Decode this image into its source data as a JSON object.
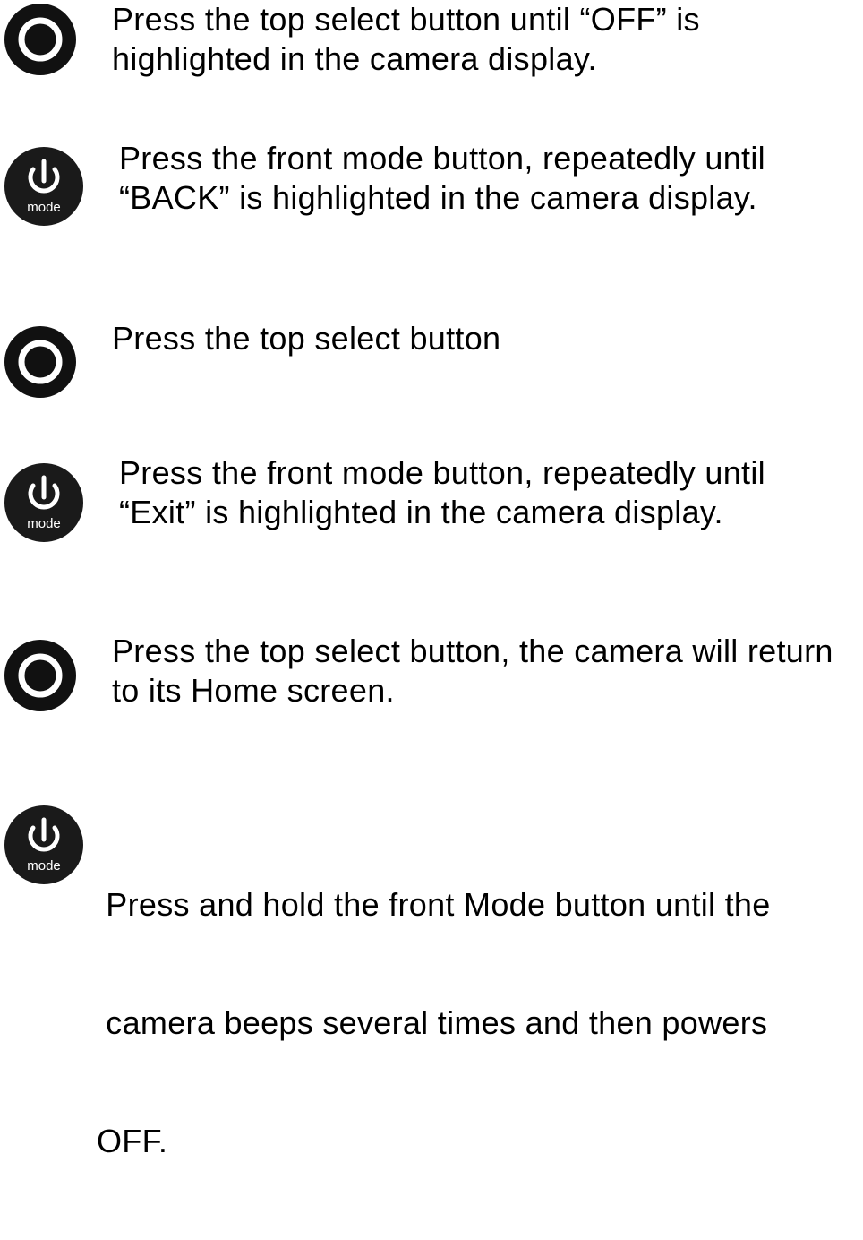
{
  "steps": [
    {
      "icon": "select-button-icon",
      "lines": [
        "Press the top select button until “OFF” is",
        "highlighted in the camera display."
      ]
    },
    {
      "icon": "mode-button-icon",
      "icon_label": "mode",
      "lines": [
        "Press the front mode button, repeatedly until",
        "“BACK” is highlighted in the camera display."
      ]
    },
    {
      "icon": "select-button-icon",
      "lines": [
        "Press the top select button"
      ]
    },
    {
      "icon": "mode-button-icon",
      "icon_label": "mode",
      "lines": [
        "Press the front mode button, repeatedly until",
        "“Exit” is highlighted in the camera display."
      ]
    },
    {
      "icon": "select-button-icon",
      "lines": [
        "Press the top select button, the camera will return",
        "to its Home screen."
      ]
    },
    {
      "icon": "mode-button-icon",
      "icon_label": "mode",
      "lines": [
        " Press and hold the front Mode button until the",
        " camera beeps several times and then powers",
        "OFF."
      ]
    }
  ],
  "colors": {
    "text": "#000000",
    "icon_body": "#111111",
    "icon_ring": "#ffffff"
  }
}
